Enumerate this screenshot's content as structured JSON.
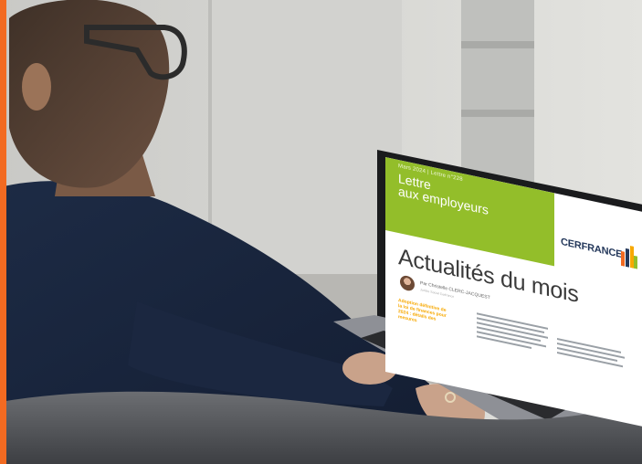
{
  "newsletter": {
    "date": "Mars 2024 | Lettre n°228",
    "title_line1": "Lettre",
    "title_line2": "aux employeurs",
    "brand": "CERFRANCE",
    "brand_tagline": "",
    "headline": "Actualités du mois",
    "author": "Par Christelle CLERC-JACQUEST",
    "author_role": "Juriste Social Cerfrance",
    "article_title": "Adoption définitive de la loi de finances pour 2024 : détails des mesures"
  },
  "colors": {
    "accent_bar": "#f26a21",
    "banner_green": "#93be2a",
    "brand_navy": "#24385b",
    "article_yellow": "#f7a800"
  },
  "icons": [
    "cerfrance-logo-icon",
    "author-avatar"
  ]
}
